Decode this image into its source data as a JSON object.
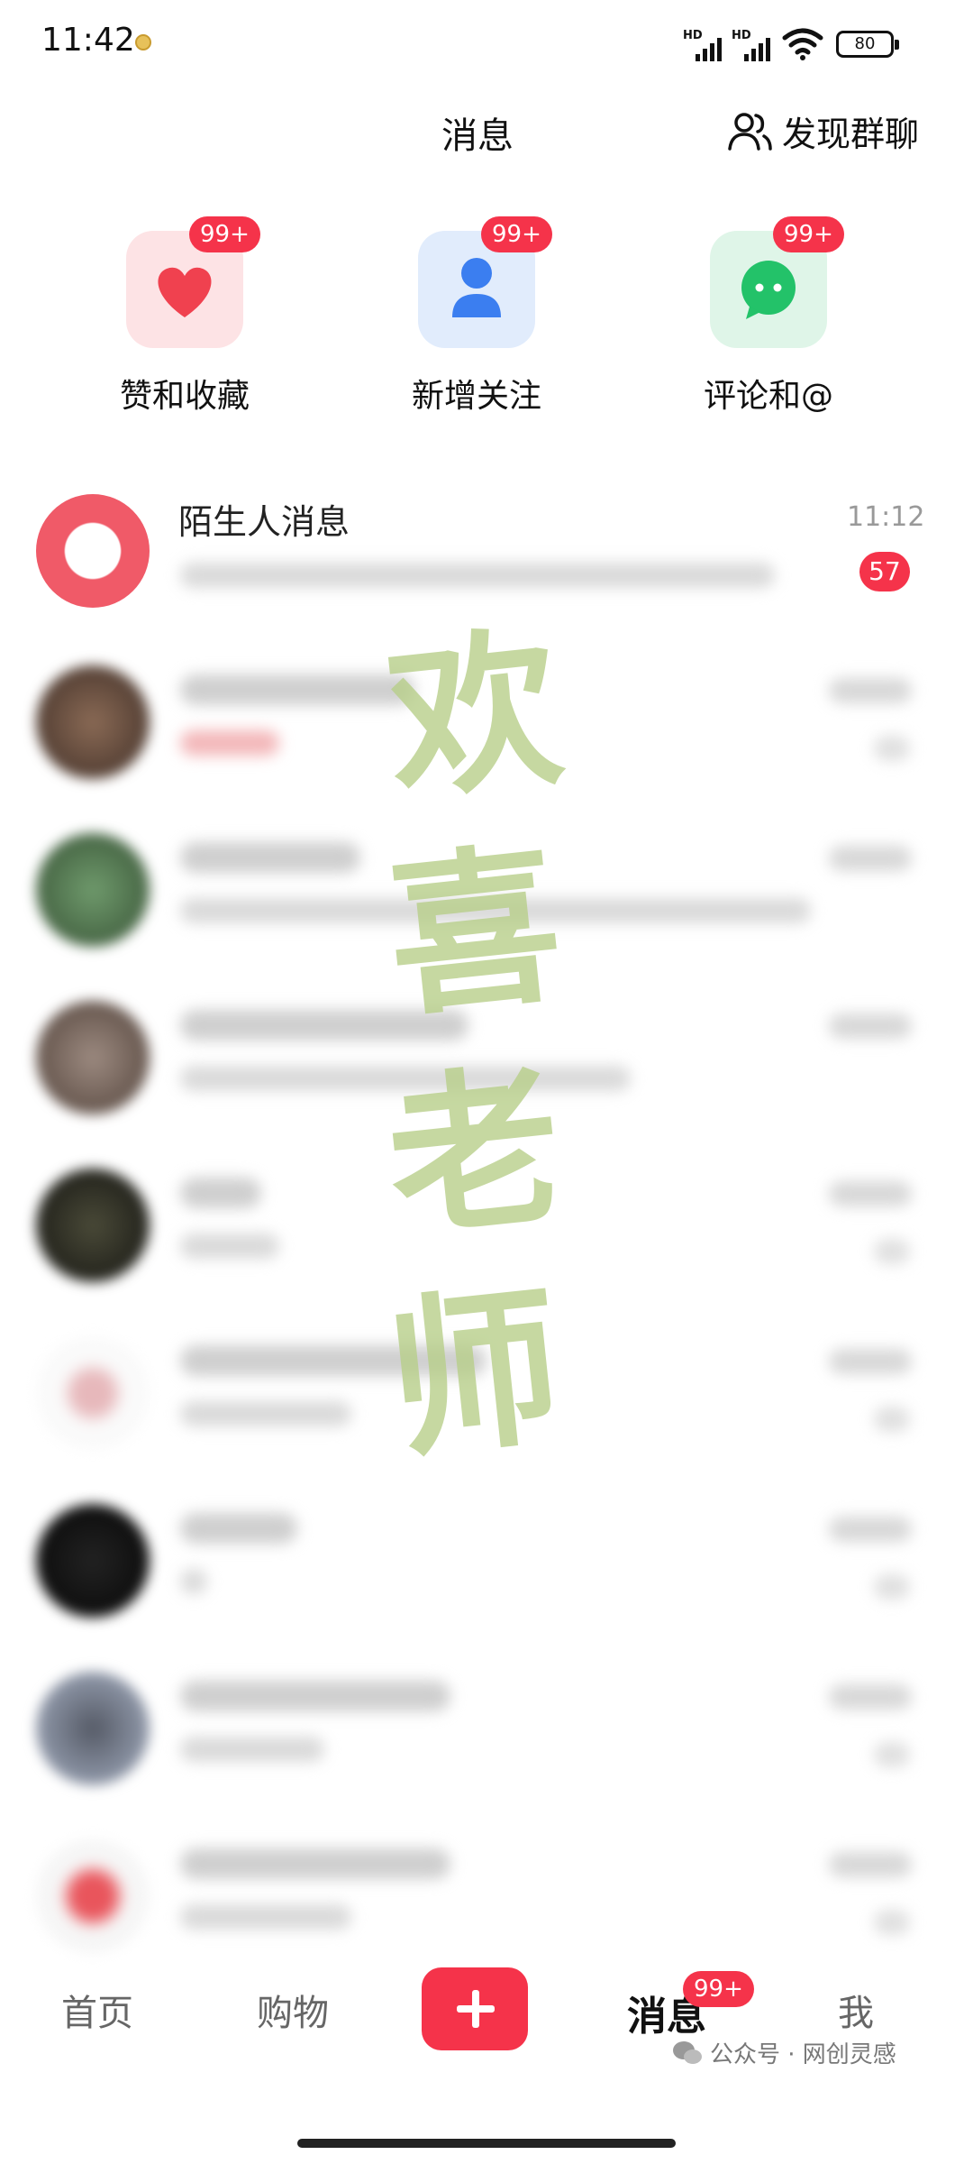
{
  "status_bar": {
    "time": "11:42",
    "battery": "80",
    "hd": "HD"
  },
  "header": {
    "title": "消息",
    "discover_label": "发现群聊"
  },
  "quick_actions": [
    {
      "label": "赞和收藏",
      "badge": "99+",
      "icon": "heart-icon",
      "color": "#f0414f"
    },
    {
      "label": "新增关注",
      "badge": "99+",
      "icon": "person-icon",
      "color": "#3b7ef0"
    },
    {
      "label": "评论和@",
      "badge": "99+",
      "icon": "chat-bubble-icon",
      "color": "#23c269"
    }
  ],
  "stranger": {
    "name": "陌生人消息",
    "time": "11:12",
    "unread": "57"
  },
  "watermark": [
    "欢",
    "喜",
    "老",
    "师"
  ],
  "bottom_nav": {
    "home": "首页",
    "shop": "购物",
    "messages": "消息",
    "messages_badge": "99+",
    "me": "我"
  },
  "footer_watermark": "公众号 · 网创灵感",
  "colors": {
    "accent": "#f5334a"
  }
}
